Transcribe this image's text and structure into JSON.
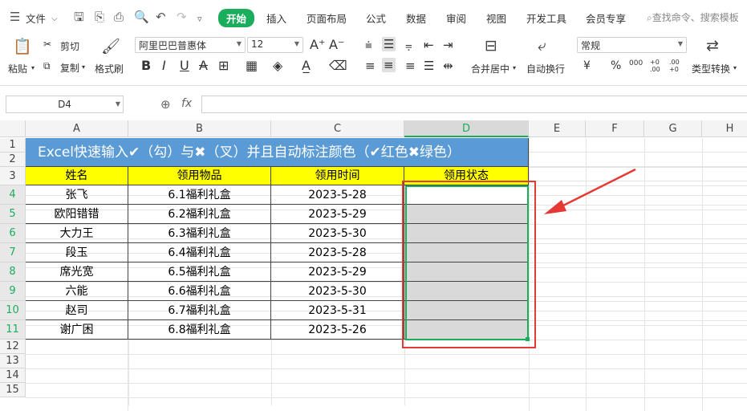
{
  "menubar": {
    "file_label": "文件",
    "tabs": [
      "开始",
      "插入",
      "页面布局",
      "公式",
      "数据",
      "审阅",
      "视图",
      "开发工具",
      "会员专享"
    ],
    "active_tab": "开始",
    "search_placeholder": "查找命令、搜索模板"
  },
  "ribbon": {
    "paste": "粘贴",
    "cut": "剪切",
    "copy": "复制",
    "format_painter": "格式刷",
    "font_name": "阿里巴巴普惠体",
    "font_size": "12",
    "merge_center": "合并居中",
    "auto_wrap": "自动换行",
    "number_format": "常规",
    "type_convert": "类型转换",
    "bold": "B",
    "italic": "I",
    "underline": "U",
    "strike": "A",
    "percent": "%",
    "thousands": "000",
    "currency": "¥",
    "dec_inc": "+0 .00",
    "dec_dec": ".00 +0"
  },
  "formula_bar": {
    "name_box": "D4",
    "fx": "fx",
    "content": ""
  },
  "columns": [
    "A",
    "B",
    "C",
    "D",
    "E",
    "F",
    "G",
    "H"
  ],
  "rows": [
    "1",
    "2",
    "3",
    "4",
    "5",
    "6",
    "7",
    "8",
    "9",
    "10",
    "11",
    "12",
    "13",
    "14",
    "15"
  ],
  "sheet": {
    "title": "Excel快速输入✔（勾）与✖（叉）并且自动标注颜色（✔红色✖绿色）",
    "headers": [
      "姓名",
      "领用物品",
      "领用时间",
      "领用状态"
    ],
    "records": [
      [
        "张飞",
        "6.1福利礼盒",
        "2023-5-28",
        ""
      ],
      [
        "欧阳错错",
        "6.2福利礼盒",
        "2023-5-29",
        ""
      ],
      [
        "大力王",
        "6.3福利礼盒",
        "2023-5-30",
        ""
      ],
      [
        "段玉",
        "6.4福利礼盒",
        "2023-5-28",
        ""
      ],
      [
        "席光宽",
        "6.5福利礼盒",
        "2023-5-29",
        ""
      ],
      [
        "六能",
        "6.6福利礼盒",
        "2023-5-30",
        ""
      ],
      [
        "赵司",
        "6.7福利礼盒",
        "2023-5-31",
        ""
      ],
      [
        "谢广困",
        "6.8福利礼盒",
        "2023-5-26",
        ""
      ]
    ]
  },
  "colors": {
    "accent": "#1aad5c",
    "title_bg": "#5b9bd5",
    "header_bg": "#ffff00",
    "annotation": "#e53935"
  }
}
